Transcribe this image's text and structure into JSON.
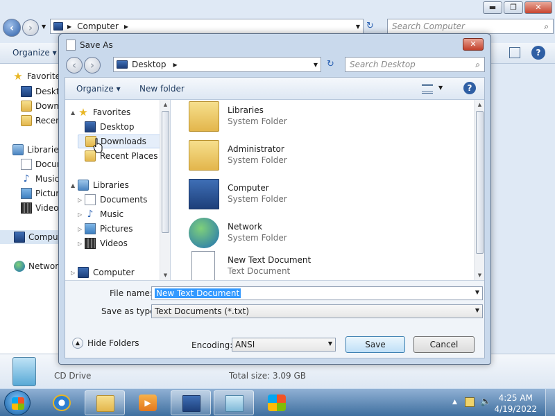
{
  "explorer": {
    "address_text": "Computer",
    "search_placeholder": "Search Computer",
    "organize_label": "Organize",
    "nav_items": [
      {
        "label": "Favorites",
        "icon": "star-icon"
      },
      {
        "label": "Desktop",
        "icon": "desktop-icon"
      },
      {
        "label": "Downloads",
        "icon": "folder-icon"
      },
      {
        "label": "Recent Places",
        "icon": "recent-icon"
      },
      {
        "label": "Libraries",
        "icon": "library-icon"
      },
      {
        "label": "Documents",
        "icon": "documents-icon"
      },
      {
        "label": "Music",
        "icon": "music-icon"
      },
      {
        "label": "Pictures",
        "icon": "pictures-icon"
      },
      {
        "label": "Videos",
        "icon": "videos-icon"
      },
      {
        "label": "Computer",
        "icon": "computer-icon"
      },
      {
        "label": "Network",
        "icon": "network-icon"
      }
    ],
    "details": {
      "drive_label": "CD Drive",
      "total_size": "Total size: 3.09 GB"
    }
  },
  "dialog": {
    "title": "Save As",
    "location": "Desktop",
    "search_placeholder": "Search Desktop",
    "organize_label": "Organize",
    "new_folder_label": "New folder",
    "tree": [
      {
        "label": "Favorites",
        "icon": "star-icon",
        "arrow": "▲"
      },
      {
        "label": "Desktop",
        "icon": "desktop-icon",
        "arrow": ""
      },
      {
        "label": "Downloads",
        "icon": "folder-icon",
        "arrow": ""
      },
      {
        "label": "Recent Places",
        "icon": "recent-icon",
        "arrow": ""
      },
      {
        "label": "Libraries",
        "icon": "library-icon",
        "arrow": "▲"
      },
      {
        "label": "Documents",
        "icon": "documents-icon",
        "arrow": "▷"
      },
      {
        "label": "Music",
        "icon": "music-icon",
        "arrow": "▷"
      },
      {
        "label": "Pictures",
        "icon": "pictures-icon",
        "arrow": "▷"
      },
      {
        "label": "Videos",
        "icon": "videos-icon",
        "arrow": "▷"
      },
      {
        "label": "Computer",
        "icon": "computer-icon",
        "arrow": "▷"
      }
    ],
    "files": [
      {
        "name": "Libraries",
        "type": "System Folder",
        "icon": "libraries-folder-icon"
      },
      {
        "name": "Administrator",
        "type": "System Folder",
        "icon": "user-folder-icon"
      },
      {
        "name": "Computer",
        "type": "System Folder",
        "icon": "computer-icon"
      },
      {
        "name": "Network",
        "type": "System Folder",
        "icon": "network-icon"
      },
      {
        "name": "New Text Document",
        "type": "Text Document",
        "icon": "text-document-icon"
      }
    ],
    "file_name_label": "File name:",
    "file_name_value": "New Text Document",
    "save_type_label": "Save as type:",
    "save_type_value": "Text Documents (*.txt)",
    "hide_folders_label": "Hide Folders",
    "encoding_label": "Encoding:",
    "encoding_value": "ANSI",
    "save_label": "Save",
    "cancel_label": "Cancel"
  },
  "taskbar": {
    "time": "4:25 AM",
    "date": "4/19/2022"
  }
}
